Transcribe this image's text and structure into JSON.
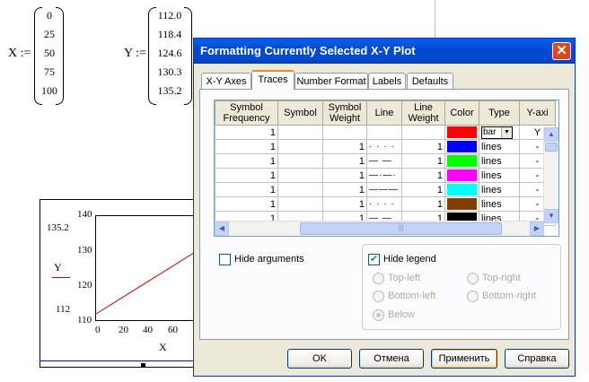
{
  "worksheet": {
    "x_def": "X :=",
    "x_values": [
      "0",
      "25",
      "50",
      "75",
      "100"
    ],
    "y_def": "Y :=",
    "y_values": [
      "112.0",
      "118.4",
      "124.6",
      "130.3",
      "135.2"
    ],
    "plot": {
      "y_ticks": [
        "140",
        "130",
        "120",
        "110"
      ],
      "x_ticks": [
        "0",
        "20",
        "40",
        "60"
      ],
      "x_label": "X",
      "y_label": "Y",
      "y_max_marker": "135.2",
      "y_min_marker": "112",
      "line_color": "#cc0000"
    }
  },
  "dialog": {
    "title": "Formatting Currently Selected X-Y Plot",
    "close_symbol": "✕",
    "tabs": [
      {
        "label": "X-Y Axes",
        "active": false
      },
      {
        "label": "Traces",
        "active": true
      },
      {
        "label": "Number Format",
        "active": false
      },
      {
        "label": "Labels",
        "active": false
      },
      {
        "label": "Defaults",
        "active": false
      }
    ],
    "table": {
      "headers": [
        "Symbol Frequency",
        "Symbol",
        "Symbol Weight",
        "Line",
        "Line Weight",
        "Color",
        "Type",
        "Y-axi"
      ],
      "rows": [
        {
          "freq": "1",
          "symbol": "",
          "sweight": "",
          "line": "",
          "lweight": "",
          "color": "#ff0000",
          "type": "bar",
          "yaxis": "Y"
        },
        {
          "freq": "1",
          "symbol": "",
          "sweight": "1",
          "line": "· · · ·",
          "lweight": "1",
          "color": "#0000ff",
          "type": "lines",
          "yaxis": "-"
        },
        {
          "freq": "1",
          "symbol": "",
          "sweight": "1",
          "line": "— —",
          "lweight": "1",
          "color": "#00ff00",
          "type": "lines",
          "yaxis": "-"
        },
        {
          "freq": "1",
          "symbol": "",
          "sweight": "1",
          "line": "—·—·",
          "lweight": "1",
          "color": "#ff00ff",
          "type": "lines",
          "yaxis": "-"
        },
        {
          "freq": "1",
          "symbol": "",
          "sweight": "1",
          "line": "———",
          "lweight": "1",
          "color": "#00ffff",
          "type": "lines",
          "yaxis": "-"
        },
        {
          "freq": "1",
          "symbol": "",
          "sweight": "1",
          "line": "· · · ·",
          "lweight": "1",
          "color": "#804000",
          "type": "lines",
          "yaxis": "-"
        },
        {
          "freq": "1",
          "symbol": "",
          "sweight": "1",
          "line": "— —",
          "lweight": "1",
          "color": "#000000",
          "type": "lines",
          "yaxis": "-"
        }
      ],
      "scroll_grip": "|||"
    },
    "hide_arguments": {
      "label": "Hide arguments",
      "checked": false
    },
    "hide_legend": {
      "label": "Hide legend",
      "checked": true
    },
    "legend_positions": {
      "top_left": "Top-left",
      "top_right": "Top-right",
      "bottom_left": "Bottom-left",
      "bottom_right": "Bottom-right",
      "below": "Below"
    },
    "buttons": {
      "ok": "OK",
      "cancel": "Отмена",
      "apply": "Применить",
      "help": "Справка"
    }
  }
}
